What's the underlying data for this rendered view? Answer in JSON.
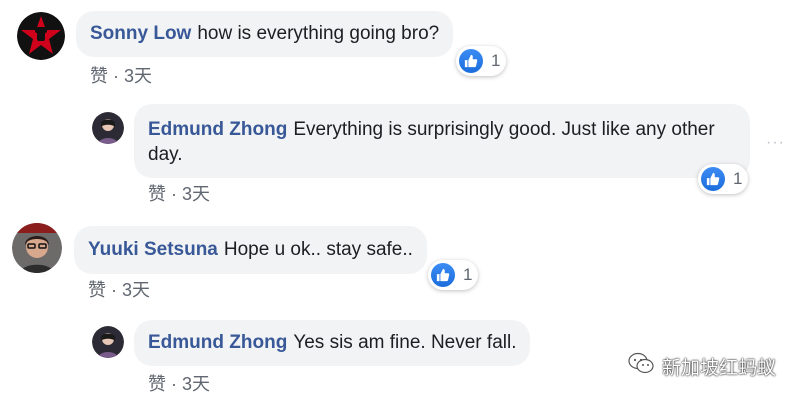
{
  "comments": [
    {
      "author": "Sonny Low",
      "text": "how is everything going bro?",
      "meta": "赞 · 3天",
      "like_count": "1",
      "avatar_icon": "star-fist-avatar"
    },
    {
      "author": "Edmund Zhong",
      "text": "Everything is surprisingly good. Just like any other day.",
      "meta": "赞 · 3天",
      "like_count": "1",
      "avatar_icon": "person-avatar"
    },
    {
      "author": "Yuuki Setsuna",
      "text": "Hope u ok.. stay safe..",
      "meta": "赞 · 3天",
      "like_count": "1",
      "avatar_icon": "person-glasses-avatar"
    },
    {
      "author": "Edmund Zhong",
      "text": "Yes sis am fine. Never fall.",
      "meta": "赞 · 3天",
      "avatar_icon": "person-avatar"
    }
  ],
  "more_options": "···",
  "watermark": {
    "text": "新加坡红蚂蚁",
    "icon": "wechat-icon"
  },
  "colors": {
    "author": "#385898",
    "bubble": "#f2f3f5",
    "like_blue": "#1b6ddb"
  }
}
